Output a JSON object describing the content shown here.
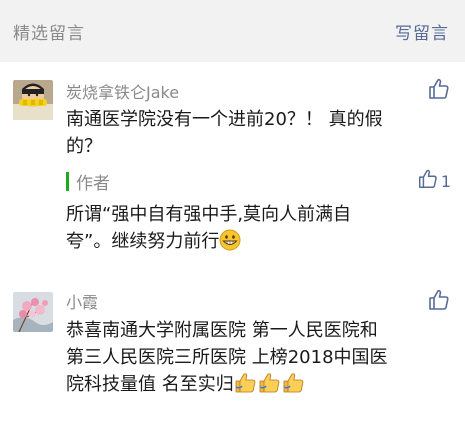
{
  "header": {
    "title": "精选留言",
    "write_label": "写留言"
  },
  "comments": [
    {
      "nickname": "炭烧拿铁仑Jake",
      "text_line1": "南通医学院没有一个进前20？！  真的假",
      "text_line2": "的？",
      "like_icon": "thumbs-up-outline-icon",
      "reply": {
        "label": "作者",
        "like_count": "1",
        "text_line1": "所谓“强中自有强中手,莫向人前满自",
        "text_line2": "夸”。继续努力前行",
        "emoji": "grinning-face-icon"
      }
    },
    {
      "nickname": "小霞",
      "text_line1": "恭喜南通大学附属医院  第一人民医院和",
      "text_line2": "第三人民医院三所医院 上榜2018中国医",
      "text_line3": "院科技量值  名至实归",
      "emoji": "thumbs-up-icon",
      "like_icon": "thumbs-up-outline-icon"
    }
  ],
  "colors": {
    "header_bg": "#f2f2f2",
    "link": "#576b95",
    "author_bar": "#1aad19",
    "meta_text": "#8a8a8a",
    "body_text": "#1a1a1a"
  }
}
